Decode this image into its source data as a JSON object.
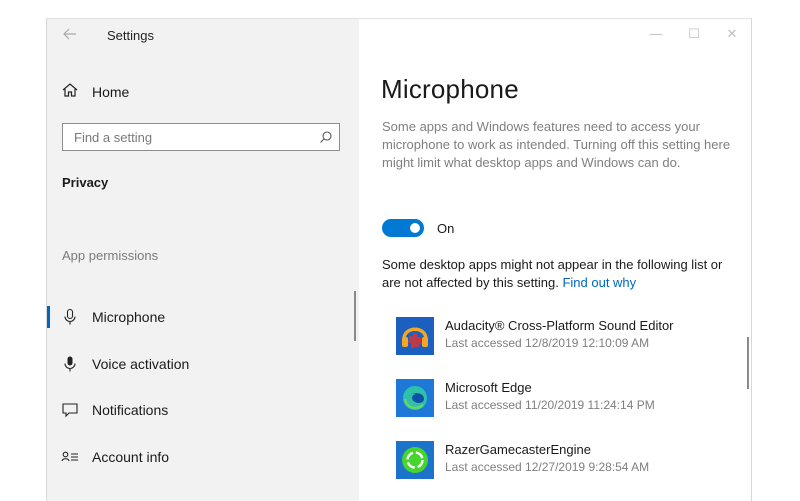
{
  "window": {
    "title": "Settings",
    "controls": {
      "minimize": "—",
      "maximize": "☐",
      "close": "✕"
    }
  },
  "sidebar": {
    "home_label": "Home",
    "search_placeholder": "Find a setting",
    "section_privacy": "Privacy",
    "section_app_permissions": "App permissions",
    "items": [
      {
        "label": "Microphone",
        "icon": "microphone-icon",
        "active": true
      },
      {
        "label": "Voice activation",
        "icon": "voice-activation-icon",
        "active": false
      },
      {
        "label": "Notifications",
        "icon": "notifications-icon",
        "active": false
      },
      {
        "label": "Account info",
        "icon": "account-info-icon",
        "active": false
      }
    ]
  },
  "main": {
    "title": "Microphone",
    "description": "Some apps and Windows features need to access your microphone to work as intended. Turning off this setting here might limit what desktop apps and Windows can do.",
    "toggle": {
      "state_label": "On",
      "on": true
    },
    "note_text": "Some desktop apps might not appear in the following list or are not affected by this setting.",
    "note_link": "Find out why",
    "apps": [
      {
        "name": "Audacity® Cross-Platform Sound Editor",
        "accessed": "Last accessed 12/8/2019 12:10:09 AM",
        "icon": "audacity-icon"
      },
      {
        "name": "Microsoft Edge",
        "accessed": "Last accessed 11/20/2019 11:24:14 PM",
        "icon": "edge-icon"
      },
      {
        "name": "RazerGamecasterEngine",
        "accessed": "Last accessed 12/27/2019 9:28:54 AM",
        "icon": "razer-icon"
      }
    ]
  },
  "colors": {
    "accent": "#0078d4",
    "link": "#0067c0",
    "sidebar_bg": "#f2f2f2"
  }
}
